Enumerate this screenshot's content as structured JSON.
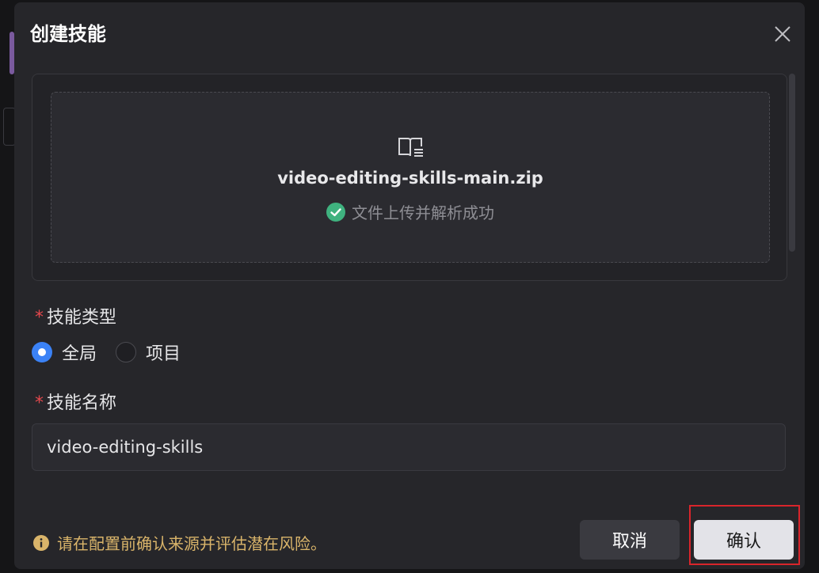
{
  "dialog": {
    "title": "创建技能"
  },
  "upload": {
    "file_name": "video-editing-skills-main.zip",
    "status_text": "文件上传并解析成功",
    "status_color": "#3fb27f"
  },
  "skill_type": {
    "label": "技能类型",
    "required_mark": "*",
    "options": [
      {
        "label": "全局",
        "selected": true
      },
      {
        "label": "项目",
        "selected": false
      }
    ]
  },
  "skill_name": {
    "label": "技能名称",
    "required_mark": "*",
    "value": "video-editing-skills"
  },
  "footer": {
    "warning_text": "请在配置前确认来源并评估潜在风险。",
    "warning_color": "#d9b46a",
    "cancel_label": "取消",
    "confirm_label": "确认"
  },
  "colors": {
    "accent": "#3b82f6",
    "required": "#e5484d",
    "highlight": "#d9252b"
  }
}
